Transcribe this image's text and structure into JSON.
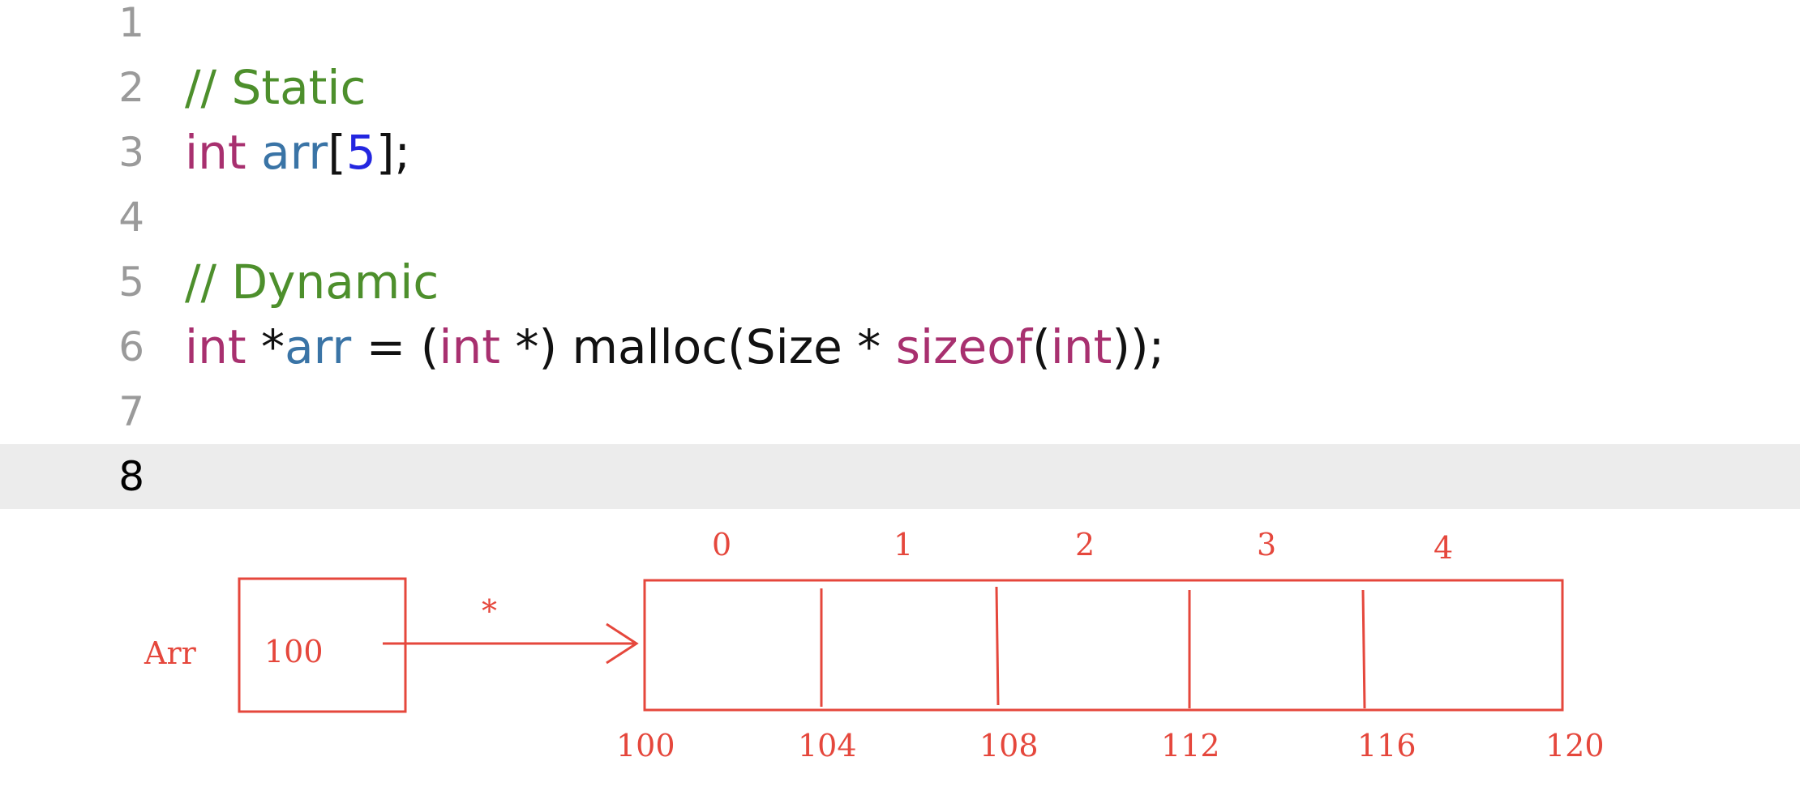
{
  "editor": {
    "lines": [
      {
        "number": "1",
        "tokens": []
      },
      {
        "number": "2",
        "tokens": [
          {
            "t": "// Static",
            "k": "comment"
          }
        ]
      },
      {
        "number": "3",
        "tokens": [
          {
            "t": "int",
            "k": "keyword"
          },
          {
            "t": " ",
            "k": "plain"
          },
          {
            "t": "arr",
            "k": "ident"
          },
          {
            "t": "[",
            "k": "plain"
          },
          {
            "t": "5",
            "k": "number"
          },
          {
            "t": "];",
            "k": "plain"
          }
        ]
      },
      {
        "number": "4",
        "tokens": []
      },
      {
        "number": "5",
        "tokens": [
          {
            "t": "// Dynamic",
            "k": "comment"
          }
        ]
      },
      {
        "number": "6",
        "tokens": [
          {
            "t": "int",
            "k": "keyword"
          },
          {
            "t": " *",
            "k": "plain"
          },
          {
            "t": "arr",
            "k": "ident"
          },
          {
            "t": " = (",
            "k": "plain"
          },
          {
            "t": "int",
            "k": "keyword"
          },
          {
            "t": " *) malloc(Size * ",
            "k": "plain"
          },
          {
            "t": "sizeof",
            "k": "keyword"
          },
          {
            "t": "(",
            "k": "plain"
          },
          {
            "t": "int",
            "k": "keyword"
          },
          {
            "t": "));",
            "k": "plain"
          }
        ]
      },
      {
        "number": "7",
        "tokens": []
      },
      {
        "number": "8",
        "tokens": [],
        "current": true
      }
    ]
  },
  "diagram": {
    "pointer_label": "Arr",
    "pointer_value": "100",
    "deref_symbol": "*",
    "indices": [
      "0",
      "1",
      "2",
      "3",
      "4"
    ],
    "addresses": [
      "100",
      "104",
      "108",
      "112",
      "116",
      "120"
    ],
    "ink_color": "#e5473c"
  }
}
